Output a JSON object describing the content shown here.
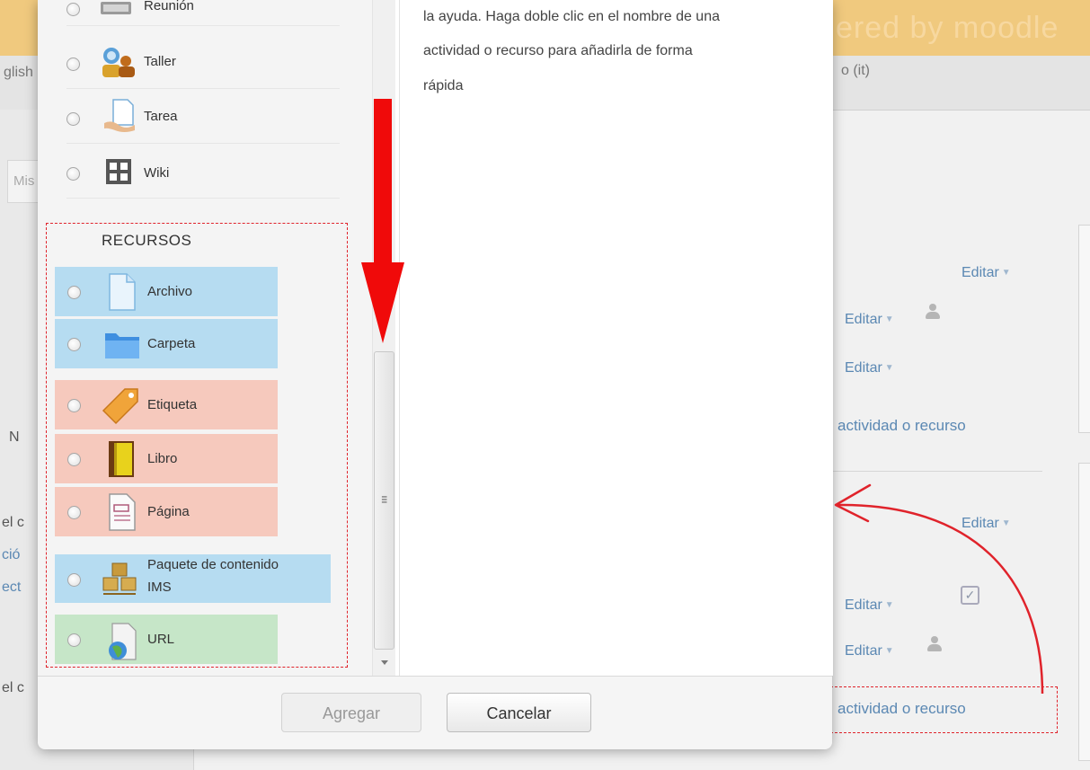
{
  "background": {
    "banner_text": "ered by moodle",
    "lang_left": "glish",
    "lang_right": "o (it)",
    "search_placeholder": "Mis",
    "left_texts": [
      "N",
      "el c",
      "ció",
      "ect",
      "el c"
    ],
    "edit_label": "Editar",
    "add_activity_label": "actividad o recurso"
  },
  "dialog": {
    "activities": [
      {
        "label": "Reunión",
        "icon": "meeting-icon"
      },
      {
        "label": "Taller",
        "icon": "workshop-icon"
      },
      {
        "label": "Tarea",
        "icon": "assignment-icon"
      },
      {
        "label": "Wiki",
        "icon": "wiki-icon"
      }
    ],
    "resources_title": "RECURSOS",
    "resources": [
      {
        "label": "Archivo",
        "icon": "file-icon",
        "color": "blue"
      },
      {
        "label": "Carpeta",
        "icon": "folder-icon",
        "color": "blue"
      },
      {
        "label": "Etiqueta",
        "icon": "label-tag-icon",
        "color": "red"
      },
      {
        "label": "Libro",
        "icon": "book-icon",
        "color": "red"
      },
      {
        "label": "Página",
        "icon": "page-icon",
        "color": "red"
      },
      {
        "label": "Paquete de contenido",
        "label2": "IMS",
        "icon": "ims-package-icon",
        "color": "blue"
      },
      {
        "label": "URL",
        "icon": "url-globe-icon",
        "color": "green"
      }
    ],
    "help_lines": [
      "la ayuda. Haga doble clic en el nombre de una",
      "actividad o recurso para añadirla de forma",
      "rápida"
    ],
    "buttons": {
      "add": "Agregar",
      "cancel": "Cancelar"
    }
  },
  "colors": {
    "annotation_red": "#e0232b",
    "blue_row": "#b6dcf1",
    "red_row": "#f6c9bd",
    "green_row": "#c6e6c8",
    "link": "#5b88b3"
  }
}
